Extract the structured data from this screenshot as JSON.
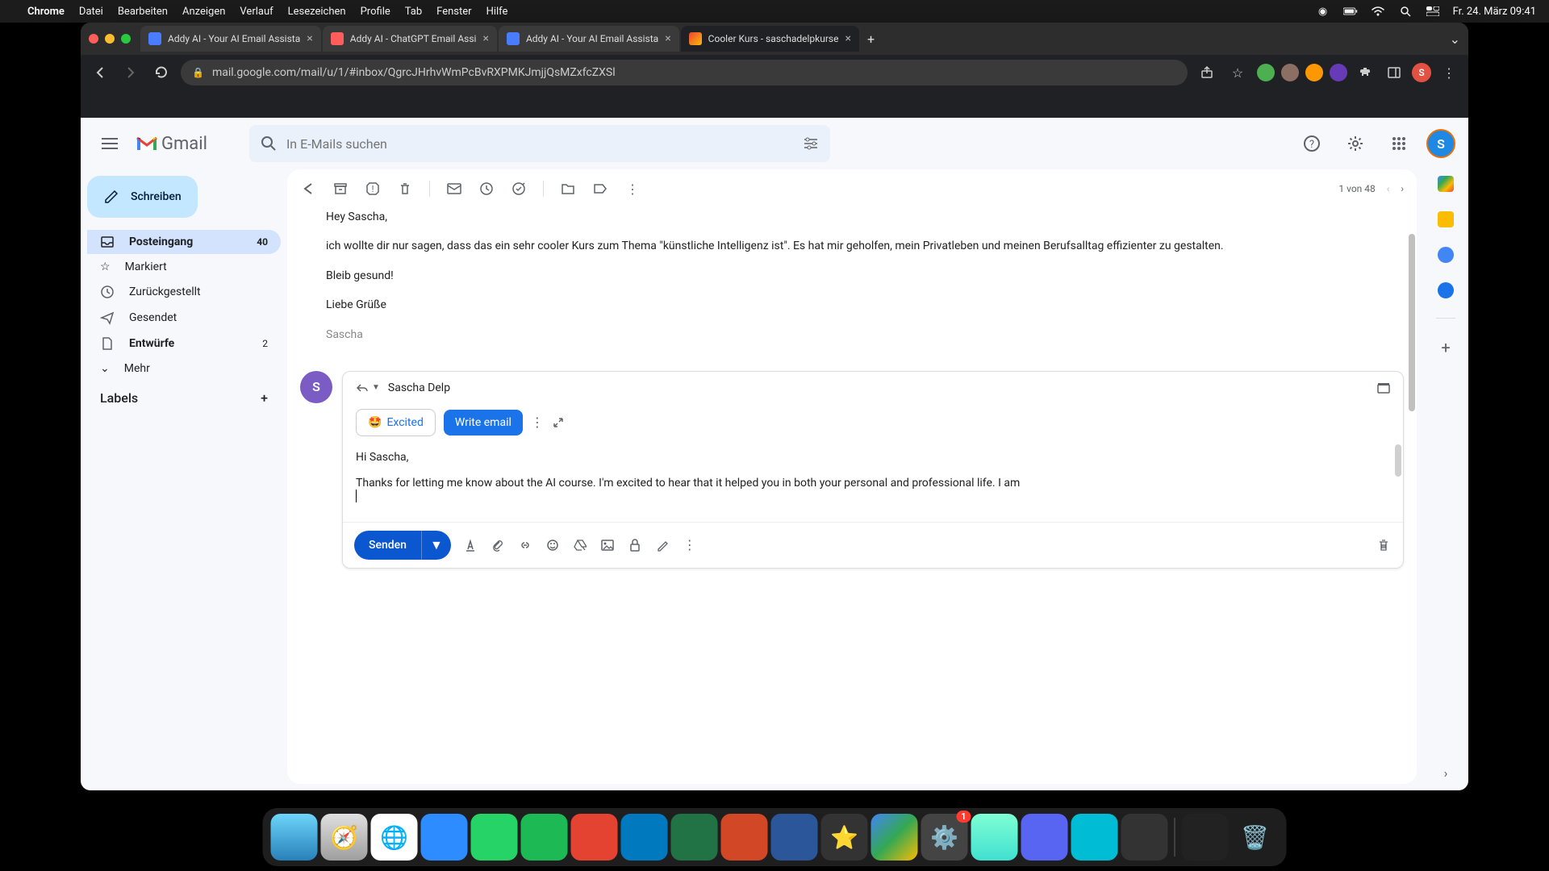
{
  "menubar": {
    "app": "Chrome",
    "items": [
      "Datei",
      "Bearbeiten",
      "Anzeigen",
      "Verlauf",
      "Lesezeichen",
      "Profile",
      "Tab",
      "Fenster",
      "Hilfe"
    ],
    "clock": "Fr. 24. März  09:41"
  },
  "tabs": [
    {
      "title": "Addy AI - Your AI Email Assista",
      "favicon": "#4a7cff"
    },
    {
      "title": "Addy AI - ChatGPT Email Assi",
      "favicon": "#ff5c5c"
    },
    {
      "title": "Addy AI - Your AI Email Assista",
      "favicon": "#4a7cff"
    },
    {
      "title": "Cooler Kurs - saschadelpkurse",
      "favicon": "#ea4335",
      "active": true
    }
  ],
  "url": "mail.google.com/mail/u/1/#inbox/QgrcJHrhvWmPcBvRXPMKJmjjQsMZxfcZXSl",
  "gmail": {
    "logo": "Gmail",
    "search_placeholder": "In E-Mails suchen",
    "compose": "Schreiben",
    "nav": {
      "inbox": {
        "label": "Posteingang",
        "count": "40"
      },
      "starred": "Markiert",
      "snoozed": "Zurückgestellt",
      "sent": "Gesendet",
      "drafts": {
        "label": "Entwürfe",
        "count": "2"
      },
      "more": "Mehr"
    },
    "labels_header": "Labels",
    "pagination": "1 von 48",
    "email": {
      "greeting": "Hey Sascha,",
      "body": "ich wollte dir nur sagen, dass das ein sehr cooler Kurs zum Thema \"künstliche Intelligenz ist\". Es hat mir geholfen, mein Privatleben und meinen Berufsalltag effizienter zu gestalten.",
      "closing": "Bleib gesund!",
      "signoff": "Liebe Grüße",
      "signature": "Sascha"
    },
    "reply": {
      "to": "Sascha Delp",
      "chip_excited": "Excited",
      "chip_write": "Write email",
      "greeting": "Hi Sascha,",
      "body": "Thanks for letting me know about the AI course. I'm excited to hear that it helped you in both your personal and professional life. I am"
    },
    "send": "Senden",
    "avatar_initial": "S"
  },
  "dock": {
    "badge": "1"
  }
}
